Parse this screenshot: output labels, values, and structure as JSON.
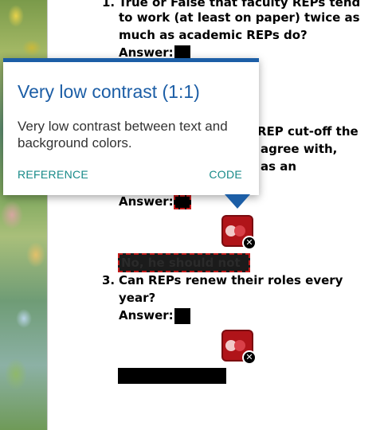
{
  "tooltip": {
    "title": "Very low contrast (1:1)",
    "body": "Very low contrast between text and background colors.",
    "reference_label": "REFERENCE",
    "code_label": "CODE"
  },
  "questions": [
    {
      "number": "1.",
      "lines": [
        "True or False that faculty REPs tend",
        "to work (at least on paper) twice as",
        "much as academic REPs do?"
      ],
      "answer_label": "Answer:"
    },
    {
      "fragments": [
        "REP cut-off the",
        "agree with,",
        "as an"
      ],
      "answer_label": "Answer:",
      "answer_text": "No, he should not"
    },
    {
      "number": "3.",
      "lines": [
        "Can REPs renew their roles every",
        "year?"
      ],
      "answer_label": "Answer:"
    }
  ],
  "badge": {
    "close_symbol": "✕"
  },
  "colors": {
    "accent": "#1c5ea6",
    "link": "#178a88",
    "error_red": "#b01419",
    "dashed_outline": "#c21a1a"
  }
}
